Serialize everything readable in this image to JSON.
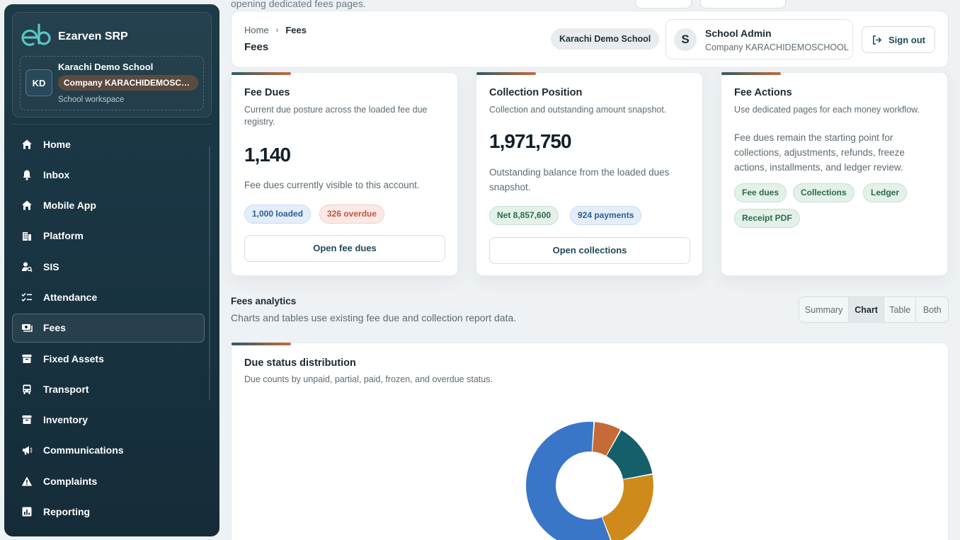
{
  "colors": {
    "sidebar_bg": "#1d3a47",
    "accent_orange": "#c56c3c",
    "donut_blue": "#3a76c8",
    "donut_orange": "#c66a37",
    "donut_teal": "#155f6b",
    "donut_gold": "#cf8a1c"
  },
  "top": {
    "partial_text": "opening dedicated fees pages."
  },
  "brand": {
    "name": "Ezarven SRP",
    "logo_icon": "eb-logo-icon"
  },
  "workspace": {
    "initials": "KD",
    "name": "Karachi Demo School",
    "company": "Company KARACHIDEMOSCHOOL",
    "subtitle": "School workspace"
  },
  "nav": {
    "items": [
      {
        "label": "Home",
        "icon": "home-icon"
      },
      {
        "label": "Inbox",
        "icon": "bell-icon"
      },
      {
        "label": "Mobile App",
        "icon": "home-icon"
      },
      {
        "label": "Platform",
        "icon": "building-icon"
      },
      {
        "label": "SIS",
        "icon": "user-search-icon"
      },
      {
        "label": "Attendance",
        "icon": "checklist-icon"
      },
      {
        "label": "Fees",
        "icon": "money-icon"
      },
      {
        "label": "Fixed Assets",
        "icon": "archive-icon"
      },
      {
        "label": "Transport",
        "icon": "bus-icon"
      },
      {
        "label": "Inventory",
        "icon": "archive-icon"
      },
      {
        "label": "Communications",
        "icon": "megaphone-icon"
      },
      {
        "label": "Complaints",
        "icon": "warning-icon"
      },
      {
        "label": "Reporting",
        "icon": "bar-chart-icon"
      }
    ],
    "active": "Fees"
  },
  "header": {
    "breadcrumb_home": "Home",
    "breadcrumb_sep": "›",
    "breadcrumb_current": "Fees",
    "title": "Fees",
    "school": "Karachi Demo School",
    "user_initial": "S",
    "user_name": "School Admin",
    "user_company": "Company KARACHIDEMOSCHOOL",
    "signout_label": "Sign out"
  },
  "cards": {
    "dues": {
      "title": "Fee Dues",
      "subtitle": "Current due posture across the loaded fee due registry.",
      "value": "1,140",
      "note": "Fee dues currently visible to this account.",
      "pill_loaded": "1,000 loaded",
      "pill_overdue": "326 overdue",
      "button": "Open fee dues"
    },
    "collection": {
      "title": "Collection Position",
      "subtitle": "Collection and outstanding amount snapshot.",
      "value": "1,971,750",
      "note": "Outstanding balance from the loaded dues snapshot.",
      "pill_net": "Net 8,857,600",
      "pill_payments": "924 payments",
      "button": "Open collections"
    },
    "actions": {
      "title": "Fee Actions",
      "subtitle": "Use dedicated pages for each money workflow.",
      "note": "Fee dues remain the starting point for collections, adjustments, refunds, freeze actions, installments, and ledger review.",
      "tags": [
        "Fee dues",
        "Collections",
        "Ledger",
        "Receipt PDF"
      ]
    }
  },
  "analytics": {
    "title": "Fees analytics",
    "subtitle": "Charts and tables use existing fee due and collection report data.",
    "modes": [
      "Summary",
      "Chart",
      "Table",
      "Both"
    ],
    "active_mode": "Chart"
  },
  "chart": {
    "title": "Due status distribution",
    "subtitle": "Due counts by unpaid, partial, paid, frozen, and overdue status."
  },
  "chart_data": {
    "type": "pie",
    "title": "Due status distribution",
    "donut": true,
    "values": [
      7,
      14,
      22,
      57
    ],
    "colors": [
      "#c66a37",
      "#155f6b",
      "#cf8a1c",
      "#3a76c8"
    ]
  }
}
